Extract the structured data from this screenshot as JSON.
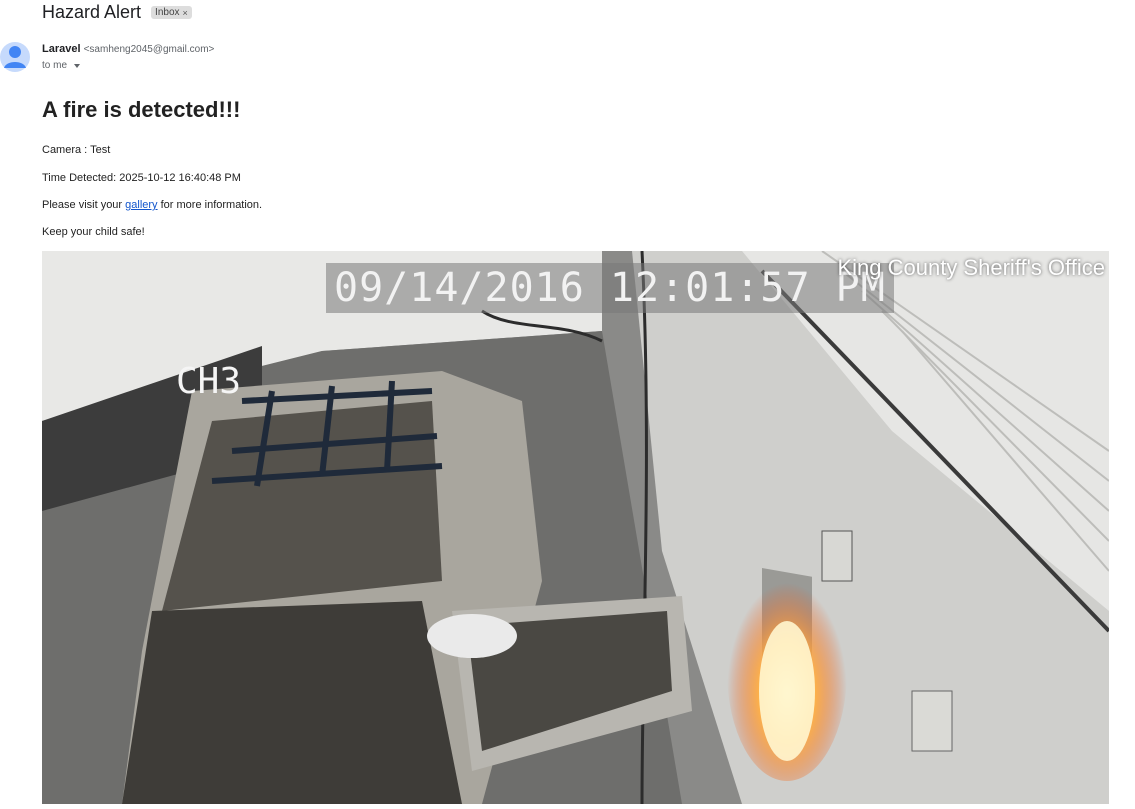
{
  "email": {
    "subject": "Hazard Alert",
    "label": "Inbox",
    "label_close": "×",
    "sender_name": "Laravel",
    "sender_email": "<samheng2045@gmail.com>",
    "to": "to me"
  },
  "body": {
    "heading": "A fire is detected!!!",
    "camera": "Camera : Test",
    "time": "Time Detected: 2025-10-12 16:40:48 PM",
    "visit_prefix": "Please visit your ",
    "gallery_link": "gallery",
    "visit_suffix": " for more information.",
    "closing": "Keep your child safe!"
  },
  "image": {
    "timestamp": "09/14/2016 12:01:57 PM",
    "watermark": "King County Sheriff's Office",
    "channel": "CH3"
  },
  "colors": {
    "link": "#1155cc",
    "avatar": "#8ab4f8"
  }
}
